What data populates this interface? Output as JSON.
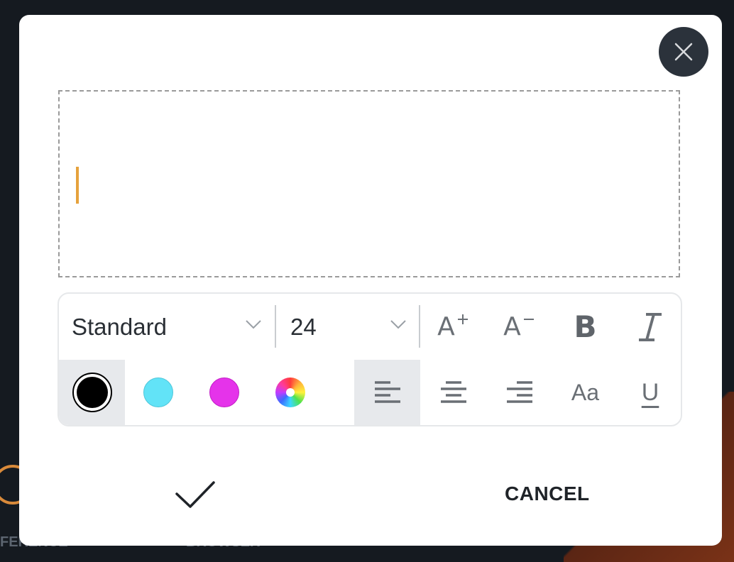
{
  "background": {
    "label_left": "FERENCE",
    "label_right": "BROWSER"
  },
  "dialog": {
    "close_icon": "close-icon",
    "text_input": {
      "value": ""
    },
    "toolbar": {
      "font_select": {
        "value": "Standard"
      },
      "size_select": {
        "value": "24"
      },
      "increase_size_label": "A",
      "decrease_size_label": "A",
      "bold_label": "B",
      "italic_label": "I",
      "case_label": "Aa",
      "underline_label": "U",
      "colors": [
        {
          "name": "black",
          "hex": "#000000",
          "selected": true
        },
        {
          "name": "cyan",
          "hex": "#62e3f7",
          "selected": false
        },
        {
          "name": "magenta",
          "hex": "#e533ea",
          "selected": false
        },
        {
          "name": "color-wheel",
          "hex": "",
          "selected": false
        }
      ],
      "alignment": [
        "left",
        "center",
        "right"
      ],
      "alignment_selected": "left"
    },
    "confirm_icon": "checkmark-icon",
    "cancel_label": "CANCEL"
  },
  "colors": {
    "caret": "#e6a23c",
    "close_button_bg": "#2b323b",
    "selected_cell_bg": "#e7e9ec"
  }
}
